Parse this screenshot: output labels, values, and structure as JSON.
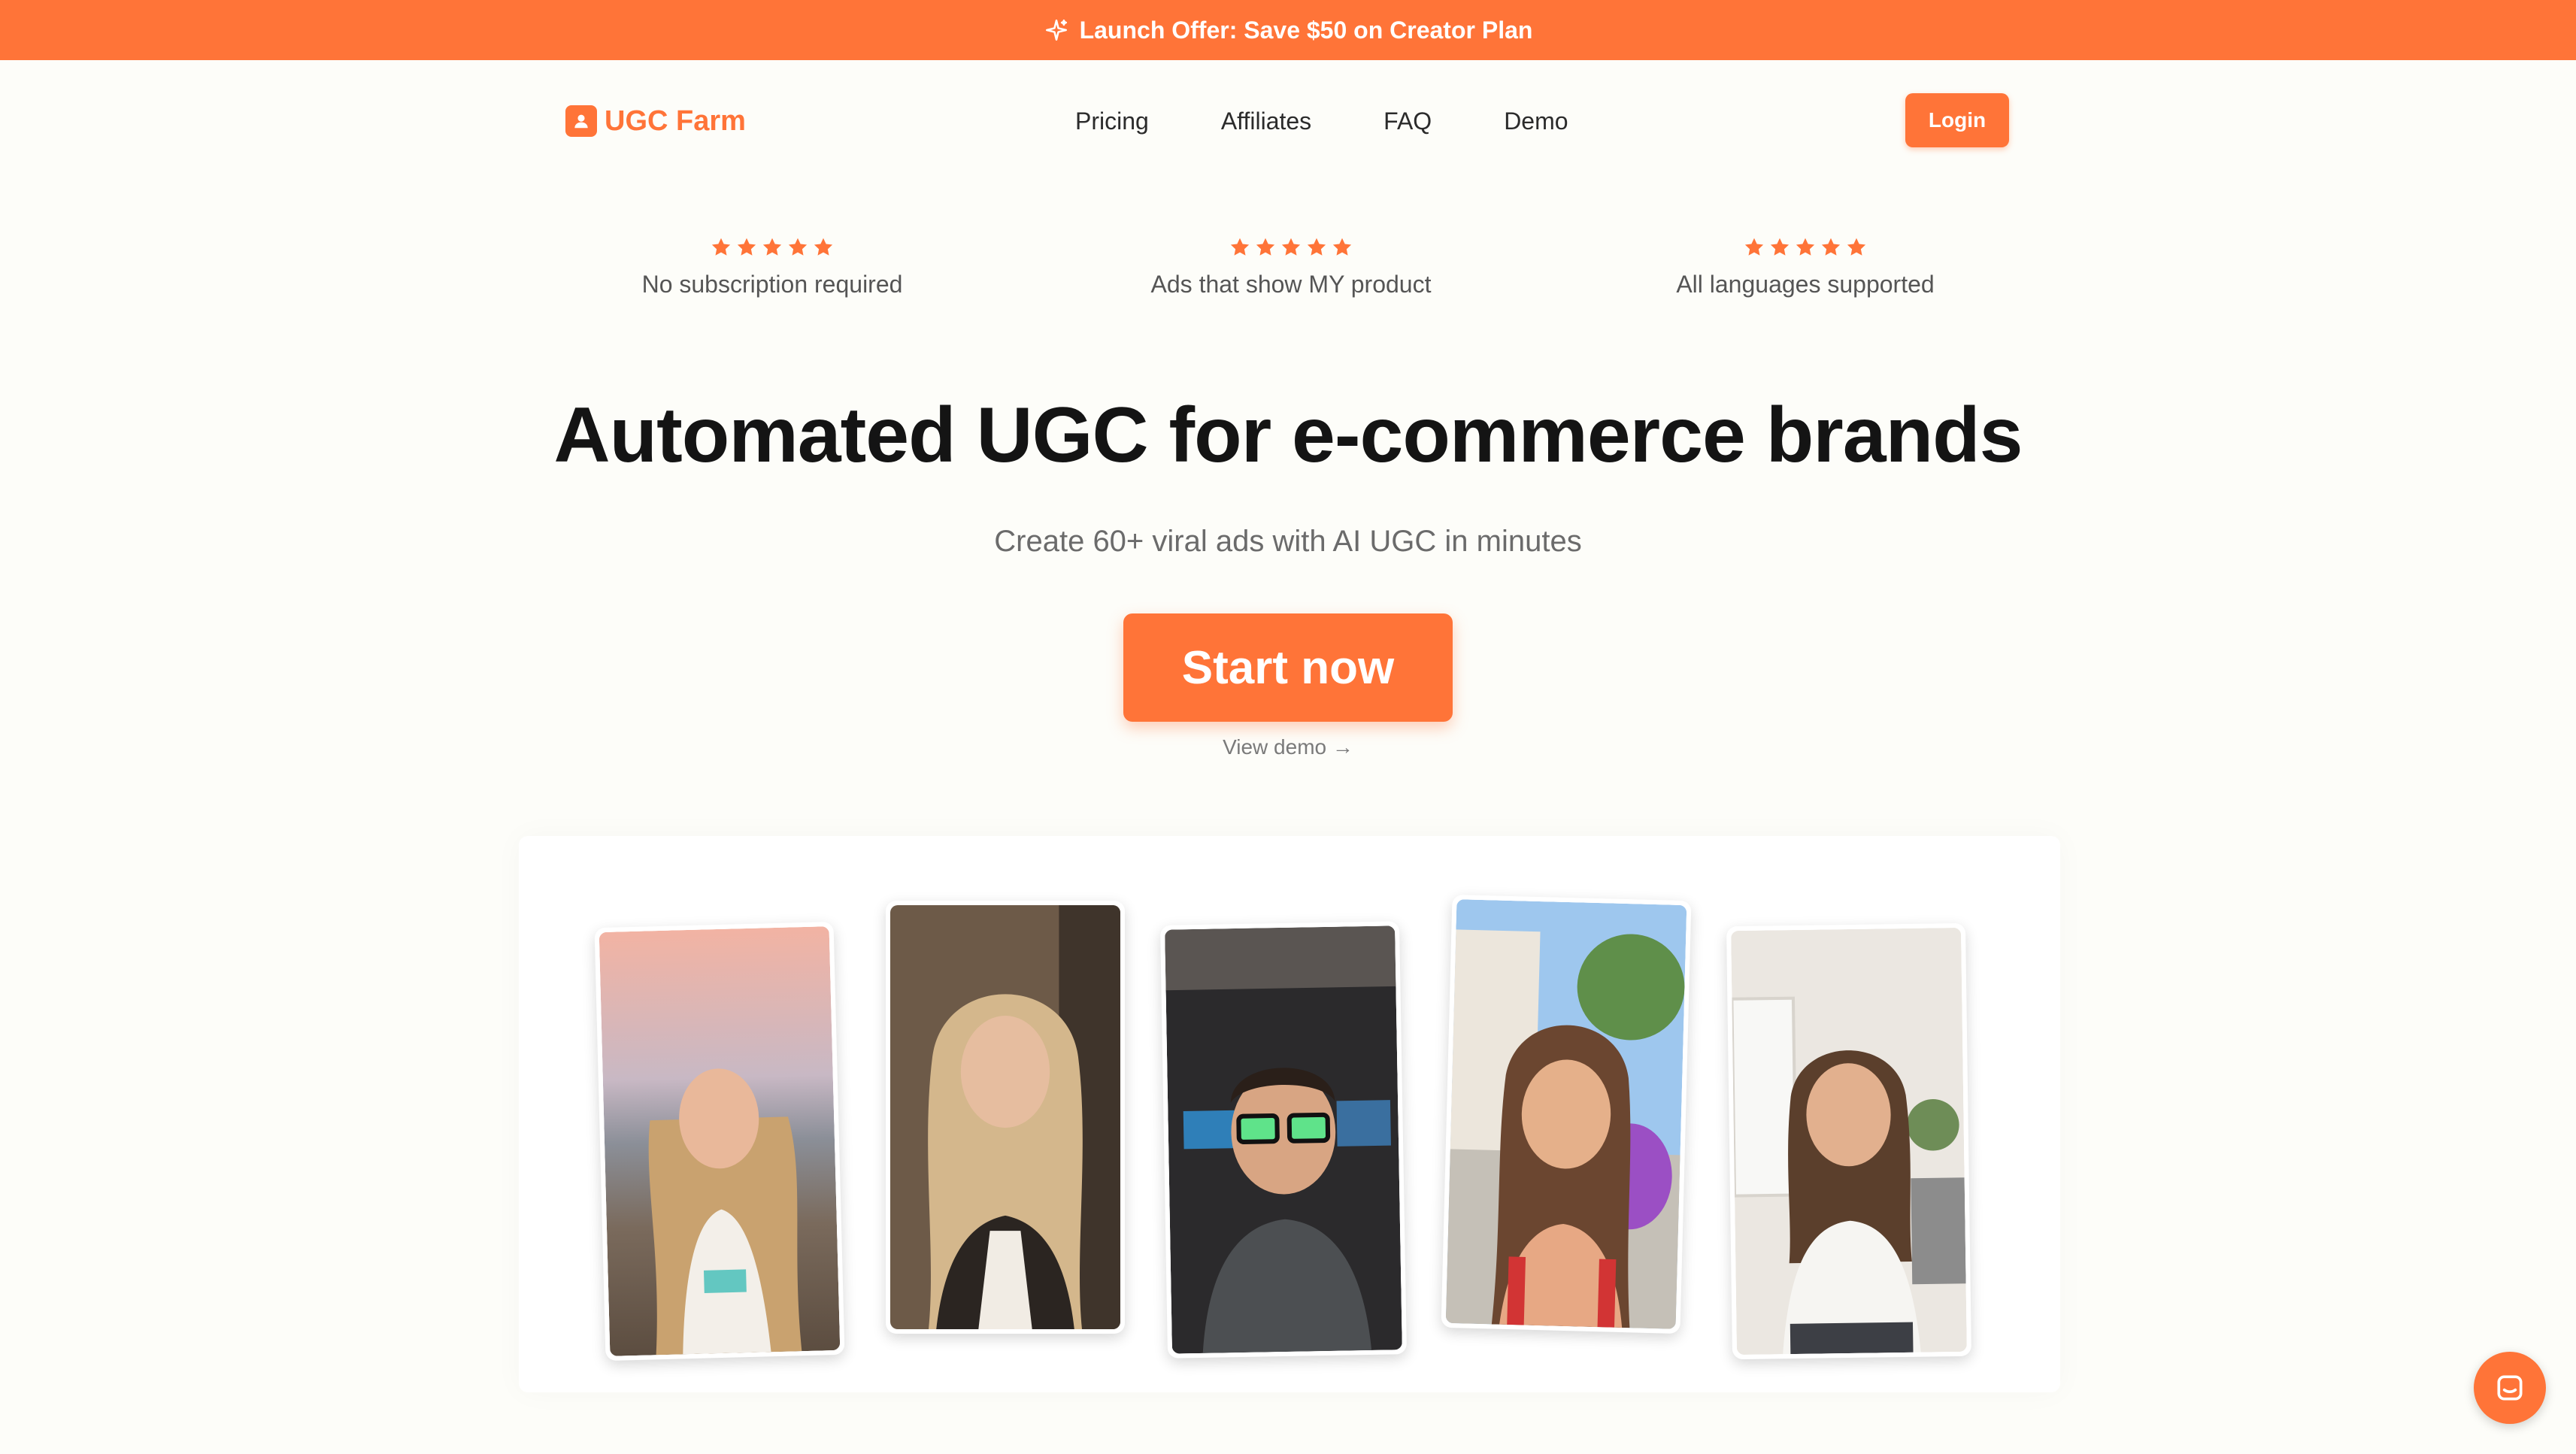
{
  "banner": {
    "text": "Launch Offer: Save $50 on Creator Plan",
    "icon": "sparkle-icon"
  },
  "nav": {
    "brand": "UGC Farm",
    "links": [
      "Pricing",
      "Affiliates",
      "FAQ",
      "Demo"
    ],
    "login": "Login"
  },
  "features": [
    {
      "label": "No subscription required",
      "stars": 5
    },
    {
      "label": "Ads that show MY product",
      "stars": 5
    },
    {
      "label": "All languages supported",
      "stars": 5
    }
  ],
  "hero": {
    "headline": "Automated UGC for e-commerce brands",
    "subhead": "Create 60+ viral ads with AI UGC in minutes",
    "cta": "Start now",
    "secondary": "View demo →"
  },
  "gallery": {
    "cards": [
      {
        "name": "beach-selfie"
      },
      {
        "name": "blonde-selfie"
      },
      {
        "name": "glasses-man-selfie"
      },
      {
        "name": "street-selfie"
      },
      {
        "name": "home-selfie"
      }
    ]
  },
  "colors": {
    "accent": "#ff7438",
    "background": "#fdfdf9",
    "text": "#141414",
    "muted": "#6b6b6b"
  },
  "chat_widget": {
    "icon": "chat-icon"
  }
}
